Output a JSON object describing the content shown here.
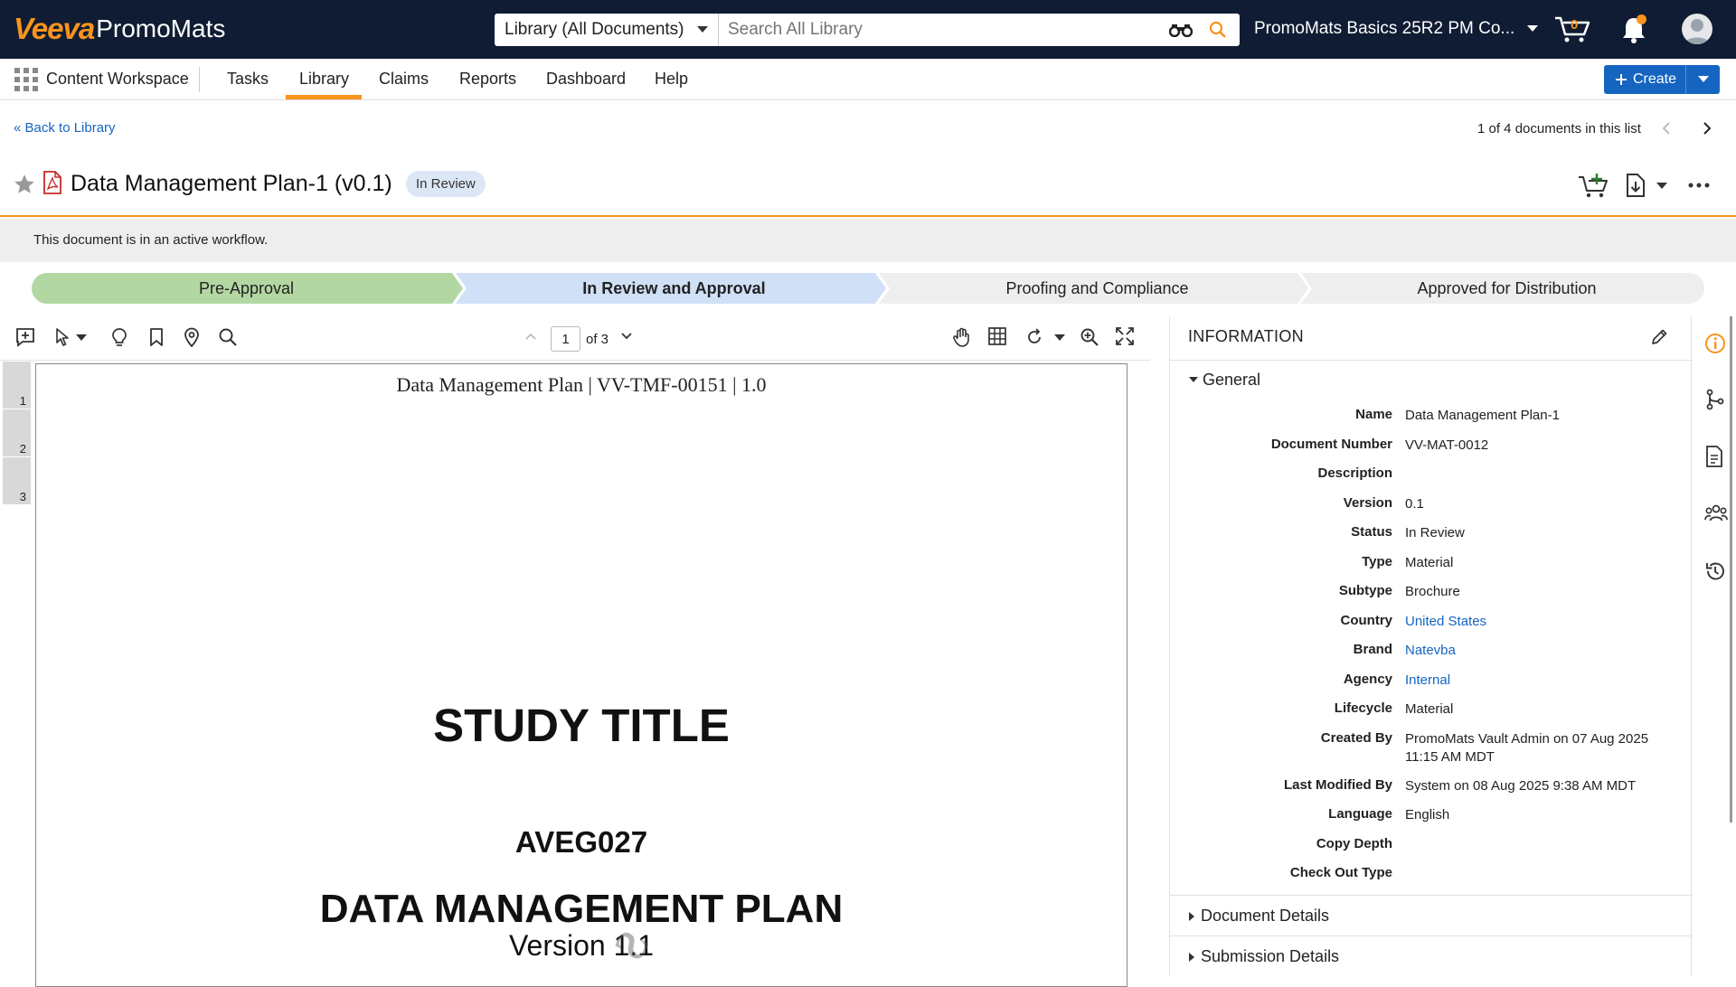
{
  "header": {
    "logo_brand": "Veeva",
    "logo_product": "PromoMats",
    "library_select": "Library (All Documents)",
    "search_placeholder": "Search All Library",
    "vault_name": "PromoMats Basics 25R2 PM Co...",
    "cart_count": "0"
  },
  "nav": {
    "workspace": "Content Workspace",
    "tabs": [
      "Tasks",
      "Library",
      "Claims",
      "Reports",
      "Dashboard",
      "Help"
    ],
    "active_tab": "Library",
    "create_label": "Create"
  },
  "breadcrumb": {
    "back_label": "Back to Library",
    "pager_text": "1 of 4 documents in this list"
  },
  "document": {
    "title": "Data Management Plan-1 (v0.1)",
    "status_badge": "In Review",
    "workflow_message": "This document is in an active workflow."
  },
  "stages": [
    {
      "label": "Pre-Approval",
      "state": "complete"
    },
    {
      "label": "In Review and Approval",
      "state": "current"
    },
    {
      "label": "Proofing and Compliance",
      "state": "pending"
    },
    {
      "label": "Approved for Distribution",
      "state": "pending"
    }
  ],
  "viewer": {
    "current_page": "1",
    "page_of": "of 3",
    "thumbnails": [
      "1",
      "2",
      "3"
    ],
    "page_header": "Data Management Plan | VV-TMF-00151 | 1.0",
    "study_title": "STUDY TITLE",
    "study_code": "AVEG027",
    "doc_heading": "DATA MANAGEMENT PLAN",
    "doc_version": "Version 1.1"
  },
  "info": {
    "heading": "INFORMATION",
    "general_label": "General",
    "fields": [
      {
        "label": "Name",
        "value": "Data Management Plan-1",
        "link": false
      },
      {
        "label": "Document Number",
        "value": "VV-MAT-0012",
        "link": false
      },
      {
        "label": "Description",
        "value": "",
        "link": false
      },
      {
        "label": "Version",
        "value": "0.1",
        "link": false
      },
      {
        "label": "Status",
        "value": "In Review",
        "link": false
      },
      {
        "label": "Type",
        "value": "Material",
        "link": false
      },
      {
        "label": "Subtype",
        "value": "Brochure",
        "link": false
      },
      {
        "label": "Country",
        "value": "United States",
        "link": true
      },
      {
        "label": "Brand",
        "value": "Natevba",
        "link": true
      },
      {
        "label": "Agency",
        "value": "Internal",
        "link": true
      },
      {
        "label": "Lifecycle",
        "value": "Material",
        "link": false
      },
      {
        "label": "Created By",
        "value": "PromoMats Vault Admin on 07 Aug 2025 11:15 AM MDT",
        "link": false
      },
      {
        "label": "Last Modified By",
        "value": "System on 08 Aug 2025 9:38 AM MDT",
        "link": false
      },
      {
        "label": "Language",
        "value": "English",
        "link": false
      },
      {
        "label": "Copy Depth",
        "value": "",
        "link": false
      },
      {
        "label": "Check Out Type",
        "value": "",
        "link": false
      }
    ],
    "sections": [
      "Document Details",
      "Submission Details"
    ]
  },
  "colors": {
    "topbar": "#0f1c33",
    "accent": "#f7941d",
    "primary": "#1565c0",
    "stage_complete": "#b3d7a2",
    "stage_current": "#cfe0f7",
    "stage_pending": "#eeeeee"
  }
}
